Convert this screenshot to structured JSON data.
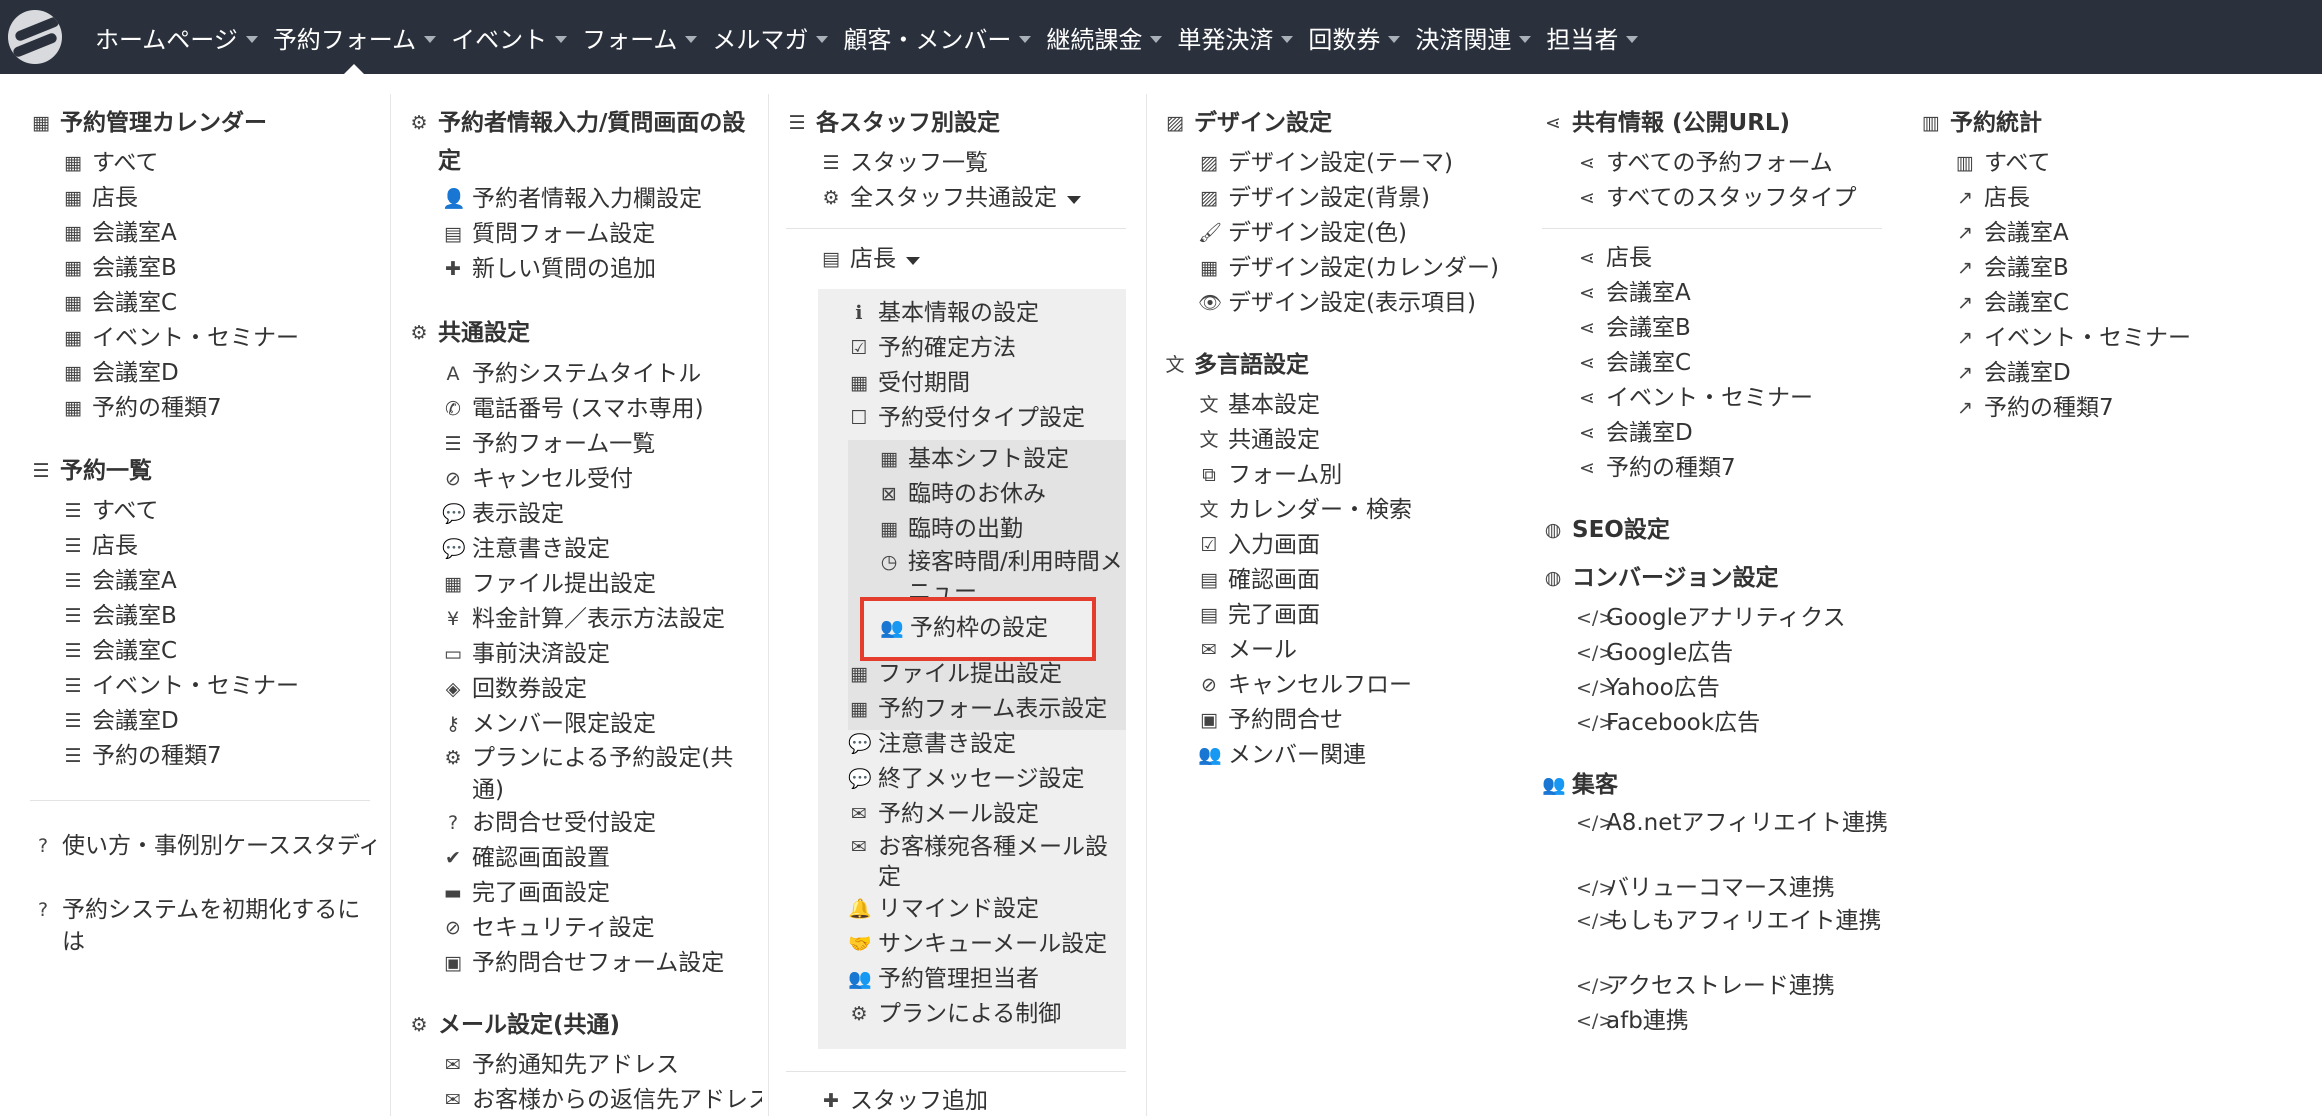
{
  "nav": {
    "items": [
      {
        "label": "ホームページ",
        "active": false
      },
      {
        "label": "予約フォーム",
        "active": true
      },
      {
        "label": "イベント",
        "active": false
      },
      {
        "label": "フォーム",
        "active": false
      },
      {
        "label": "メルマガ",
        "active": false
      },
      {
        "label": "顧客・メンバー",
        "active": false
      },
      {
        "label": "継続課金",
        "active": false
      },
      {
        "label": "単発決済",
        "active": false
      },
      {
        "label": "回数券",
        "active": false
      },
      {
        "label": "決済関連",
        "active": false
      },
      {
        "label": "担当者",
        "active": false
      }
    ]
  },
  "col1": {
    "calendar_head": "予約管理カレンダー",
    "calendar_items": [
      "すべて",
      "店長",
      "会議室A",
      "会議室B",
      "会議室C",
      "イベント・セミナー",
      "会議室D",
      "予約の種類7"
    ],
    "list_head": "予約一覧",
    "list_items": [
      "すべて",
      "店長",
      "会議室A",
      "会議室B",
      "会議室C",
      "イベント・セミナー",
      "会議室D",
      "予約の種類7"
    ],
    "help1": "使い方・事例別ケーススタディ",
    "help2": "予約システムを初期化するには"
  },
  "col2": {
    "head1": "予約者情報入力/質問画面の設定",
    "items1": [
      "予約者情報入力欄設定",
      "質問フォーム設定",
      "新しい質問の追加"
    ],
    "head2": "共通設定",
    "items2": [
      "予約システムタイトル",
      "電話番号 (スマホ専用)",
      "予約フォーム一覧",
      "キャンセル受付",
      "表示設定",
      "注意書き設定",
      "ファイル提出設定",
      "料金計算／表示方法設定",
      "事前決済設定",
      "回数券設定",
      "メンバー限定設定",
      "プランによる予約設定(共通)",
      "お問合せ受付設定",
      "確認画面設置",
      "完了画面設定",
      "セキュリティ設定",
      "予約問合せフォーム設定"
    ],
    "head3": "メール設定(共通)",
    "items3": [
      "予約通知先アドレス",
      "お客様からの返信先アドレス"
    ]
  },
  "col3": {
    "head": "各スタッフ別設定",
    "staff_list": "スタッフ一覧",
    "staff_common": "全スタッフ共通設定",
    "staff_selected": "店長",
    "sub_items1": [
      "基本情報の設定",
      "予約確定方法",
      "受付期間",
      "予約受付タイプ設定"
    ],
    "sub_items2": [
      "基本シフト設定",
      "臨時のお休み",
      "臨時の出勤",
      "接客時間/利用時間メニュー"
    ],
    "highlighted": "予約枠の設定",
    "sub_items3": [
      "ファイル提出設定",
      "予約フォーム表示設定",
      "注意書き設定",
      "終了メッセージ設定",
      "予約メール設定",
      "お客様宛各種メール設定",
      "リマインド設定",
      "サンキューメール設定",
      "予約管理担当者",
      "プランによる制御"
    ],
    "add_staff": "スタッフ追加"
  },
  "col4": {
    "head1": "デザイン設定",
    "items1": [
      "デザイン設定(テーマ)",
      "デザイン設定(背景)",
      "デザイン設定(色)",
      "デザイン設定(カレンダー)",
      "デザイン設定(表示項目)"
    ],
    "head2": "多言語設定",
    "items2": [
      "基本設定",
      "共通設定",
      "フォーム別",
      "カレンダー・検索",
      "入力画面",
      "確認画面",
      "完了画面",
      "メール",
      "キャンセルフロー",
      "予約問合せ",
      "メンバー関連"
    ]
  },
  "col5": {
    "head1": "共有情報 (公開URL)",
    "items1": [
      "すべての予約フォーム",
      "すべてのスタッフタイプ"
    ],
    "items1b": [
      "店長",
      "会議室A",
      "会議室B",
      "会議室C",
      "イベント・セミナー",
      "会議室D",
      "予約の種類7"
    ],
    "seo": "SEO設定",
    "conv": "コンバージョン設定",
    "conv_items": [
      "Googleアナリティクス",
      "Google広告",
      "Yahoo広告",
      "Facebook広告"
    ],
    "shukyaku": "集客",
    "shukyaku_items": [
      "A8.netアフィリエイト連携",
      "バリューコマース連携",
      "もしもアフィリエイト連携",
      "アクセストレード連携",
      "afb連携"
    ]
  },
  "col6": {
    "head": "予約統計",
    "items": [
      "すべて",
      "店長",
      "会議室A",
      "会議室B",
      "会議室C",
      "イベント・セミナー",
      "会議室D",
      "予約の種類7"
    ]
  },
  "colors": {
    "navbar": "#2b313c",
    "highlight": "#e43d2d",
    "submenu": "#efefef"
  }
}
